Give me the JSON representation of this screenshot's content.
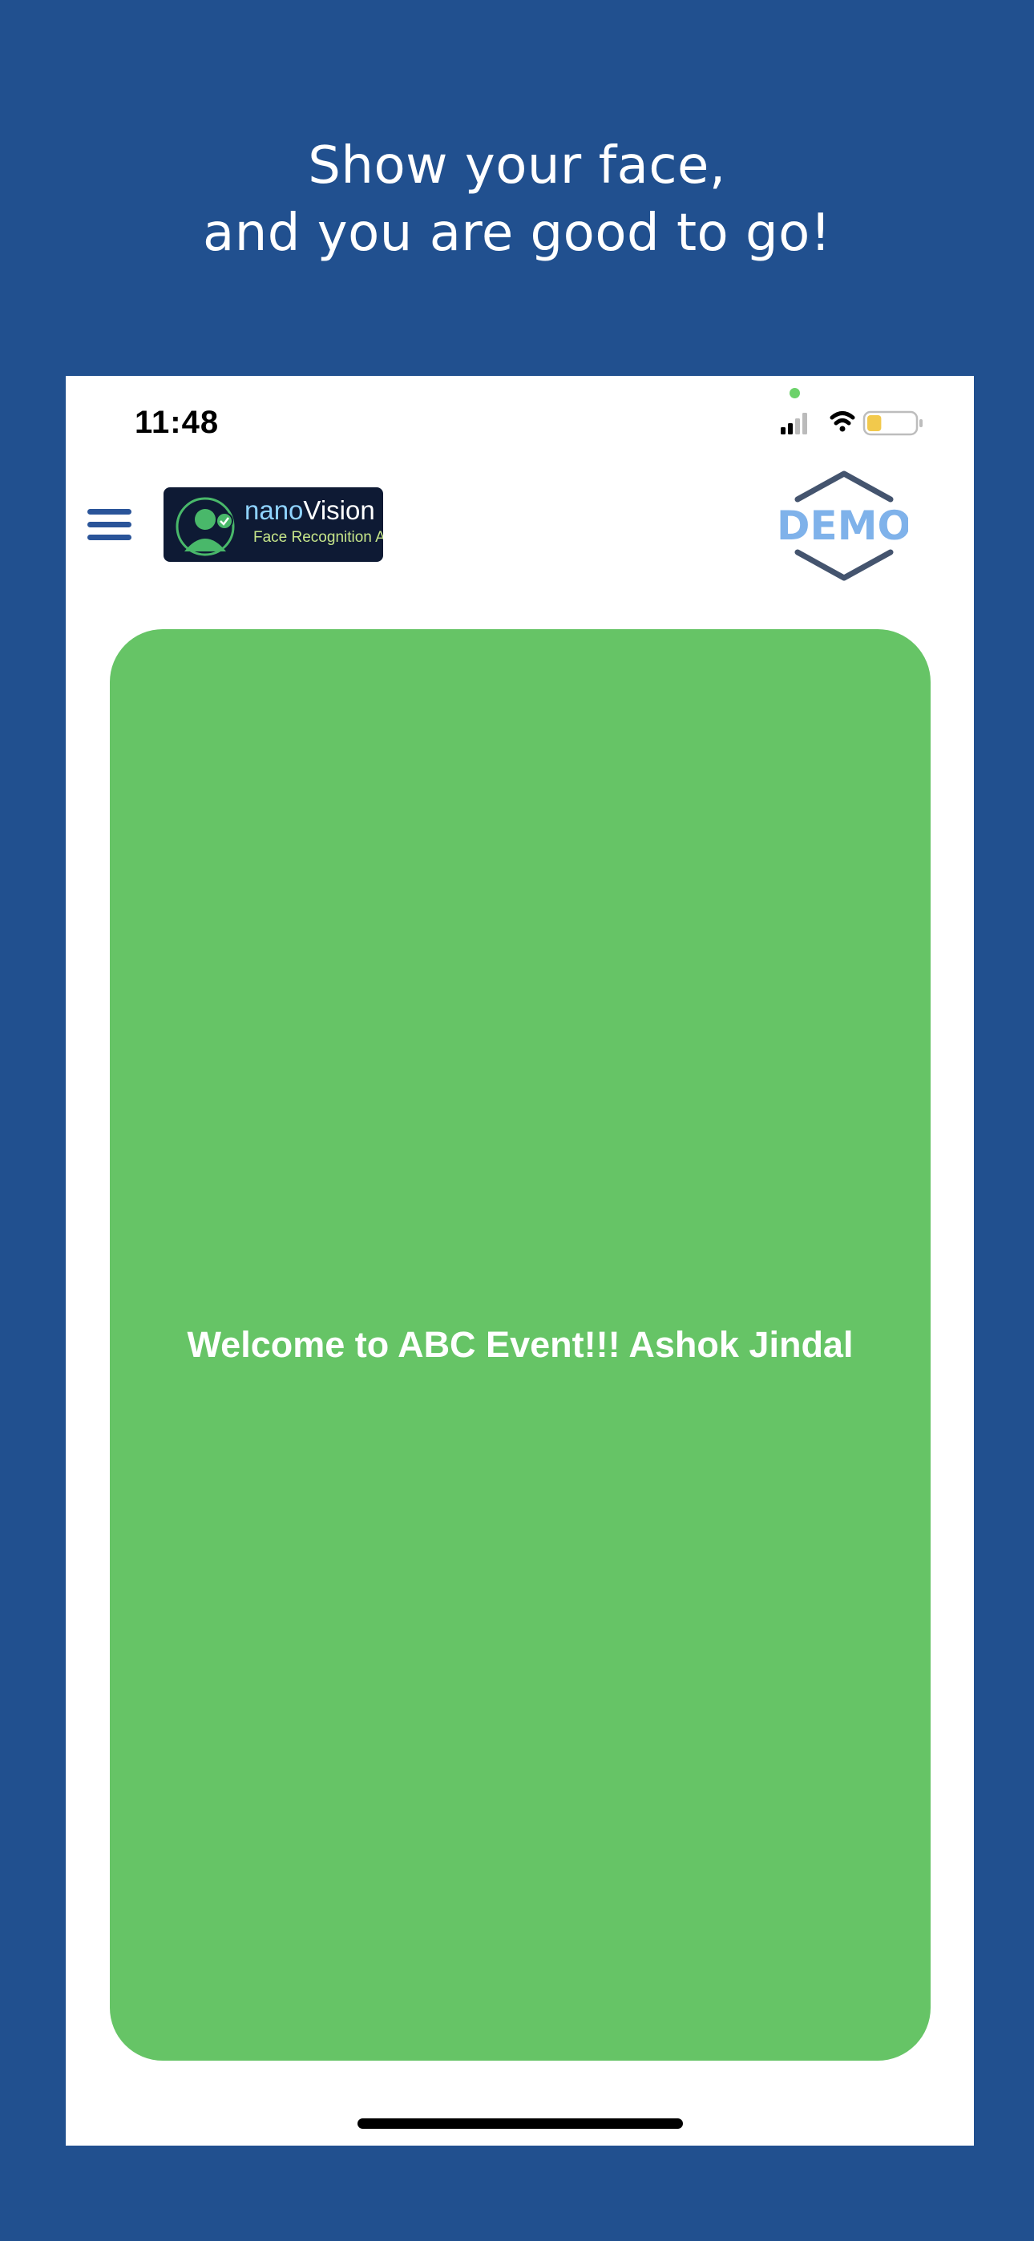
{
  "headline": {
    "line1": "Show your face,",
    "line2": "and you are good to go!"
  },
  "status_bar": {
    "time": "11:48",
    "signal_icon": "cellular-signal-icon",
    "wifi_icon": "wifi-icon",
    "battery_icon": "battery-icon",
    "battery_level": 0.3,
    "battery_color": "#f2c94c"
  },
  "header": {
    "menu_icon": "hamburger-menu-icon",
    "logo": {
      "word_part1": "nano",
      "word_part2": "Vision",
      "subtitle": "Face Recognition AI"
    },
    "badge_text": "DEMO"
  },
  "main": {
    "welcome_message": "Welcome to ABC Event!!! Ashok Jindal",
    "card_color": "#66c466"
  },
  "colors": {
    "background": "#21508f",
    "accent_blue": "#2a5499",
    "demo_text": "#7fb2ea",
    "demo_border": "#44546e"
  }
}
